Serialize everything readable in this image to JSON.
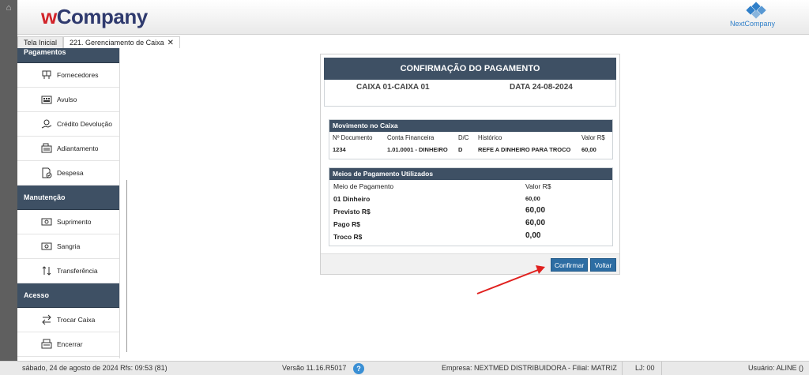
{
  "header": {
    "logo_w": "w",
    "logo_company": "Company",
    "brand_logo_label": "NextCompany"
  },
  "tabs": [
    {
      "label": "Tela Inicial"
    },
    {
      "label": "221. Gerenciamento de Caixa",
      "close": "✕"
    }
  ],
  "sidebar": {
    "sections": [
      {
        "title": "Pagamentos"
      },
      {
        "title": "Manutenção"
      },
      {
        "title": "Acesso"
      }
    ],
    "items": [
      {
        "label": "Fornecedores",
        "icon": "truck-icon"
      },
      {
        "label": "Avulso",
        "icon": "keyboard-icon"
      },
      {
        "label": "Crédito Devolução",
        "icon": "money-hand-icon"
      },
      {
        "label": "Adiantamento",
        "icon": "cash-register-icon"
      },
      {
        "label": "Despesa",
        "icon": "document-check-icon"
      },
      {
        "label": "Suprimento",
        "icon": "cash-in-icon"
      },
      {
        "label": "Sangria",
        "icon": "cash-out-icon"
      },
      {
        "label": "Transferência",
        "icon": "transfer-arrows-icon"
      },
      {
        "label": "Trocar Caixa",
        "icon": "swap-icon"
      },
      {
        "label": "Encerrar",
        "icon": "register-close-icon"
      }
    ]
  },
  "confirmacao": {
    "title": "CONFIRMAÇÃO DO PAGAMENTO",
    "caixa": "CAIXA  01-CAIXA 01",
    "data": "DATA  24-08-2024"
  },
  "movimento": {
    "title": "Movimento no Caixa",
    "headers": [
      "Nº Documento",
      "Conta Financeira",
      "D/C",
      "Histórico",
      "Valor R$"
    ],
    "row": [
      "1234",
      "1.01.0001 - DINHEIRO",
      "D",
      "REFE A DINHEIRO PARA TROCO",
      "60,00"
    ]
  },
  "meios": {
    "title": "Meios de Pagamento Utilizados",
    "header_label": "Meio de Pagamento",
    "header_value": "Valor R$",
    "rows": [
      {
        "label": "01 Dinheiro",
        "value": "60,00"
      },
      {
        "label": "Previsto R$",
        "value": "60,00"
      },
      {
        "label": "Pago R$",
        "value": "60,00"
      },
      {
        "label": "Troco R$",
        "value": "0,00"
      }
    ]
  },
  "buttons": {
    "confirm": "Confirmar",
    "back": "Voltar"
  },
  "status": {
    "date": "sábado, 24 de agosto de 2024  Rfs: 09:53 (81)",
    "version": "Versão 11.16.R5017",
    "help": "?",
    "empresa": "Empresa: NEXTMED DISTRIBUIDORA - Filial: MATRIZ",
    "loja": "LJ: 00",
    "usuario": "Usuário: ALINE ()"
  },
  "colors": {
    "header_dark": "#3e5064",
    "button_blue": "#2d6da3",
    "logo_red": "#d2242a",
    "logo_navy": "#2f3a6e",
    "annotation_arrow": "#e0201e"
  }
}
